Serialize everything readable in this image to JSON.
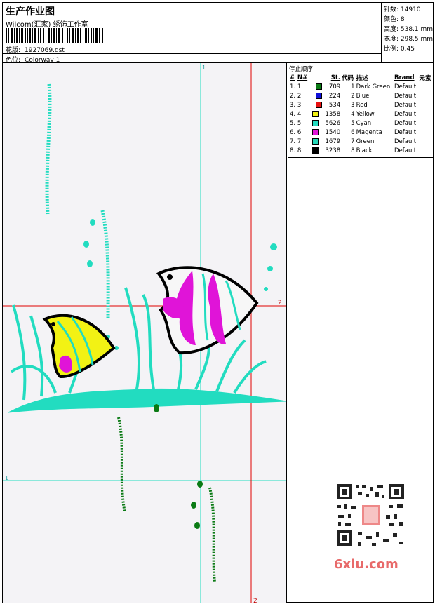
{
  "header": {
    "title": "生产作业图",
    "company": "Wilcom(汇家) 绣饰工作室",
    "design_label": "花版:",
    "design_value": "1927069.dst",
    "colorway_label": "色位:",
    "colorway_value": "Colorway 1"
  },
  "stats": {
    "stitches": "针数: 14910",
    "colors": "颜色: 8",
    "height": "高度: 538.1 mm",
    "width": "宽度: 298.5 mm",
    "scale": "比例: 0.45"
  },
  "stop_sequence": {
    "caption": "停止顺序:",
    "headers": [
      "#",
      "N#",
      "St.",
      "代码",
      "描述",
      "Brand",
      "元素"
    ],
    "rows": [
      {
        "idx": "1.",
        "n": "1",
        "color": "#0a7a14",
        "st": "709",
        "code": "1",
        "desc": "Dark Green",
        "brand": "Default"
      },
      {
        "idx": "2.",
        "n": "2",
        "color": "#1010d8",
        "st": "224",
        "code": "2",
        "desc": "Blue",
        "brand": "Default"
      },
      {
        "idx": "3.",
        "n": "3",
        "color": "#e81010",
        "st": "534",
        "code": "3",
        "desc": "Red",
        "brand": "Default"
      },
      {
        "idx": "4.",
        "n": "4",
        "color": "#f2f214",
        "st": "1358",
        "code": "4",
        "desc": "Yellow",
        "brand": "Default"
      },
      {
        "idx": "5.",
        "n": "5",
        "color": "#22dcc0",
        "st": "5626",
        "code": "5",
        "desc": "Cyan",
        "brand": "Default"
      },
      {
        "idx": "6.",
        "n": "6",
        "color": "#e014d8",
        "st": "1540",
        "code": "6",
        "desc": "Magenta",
        "brand": "Default"
      },
      {
        "idx": "7.",
        "n": "7",
        "color": "#22d8b8",
        "st": "1679",
        "code": "7",
        "desc": "Green",
        "brand": "Default"
      },
      {
        "idx": "8.",
        "n": "8",
        "color": "#000000",
        "st": "3238",
        "code": "8",
        "desc": "Black",
        "brand": "Default"
      }
    ]
  },
  "guides": {
    "cyan_top": "1",
    "cyan_left": "1",
    "red_right": "2",
    "red_bottom": "2"
  },
  "watermark": "6xiu.com",
  "colors": {
    "cyan": "#22dcc0",
    "magenta": "#e014d8",
    "yellow": "#f2f214",
    "dark_green": "#0a7a14",
    "red_guide": "#e00000"
  }
}
